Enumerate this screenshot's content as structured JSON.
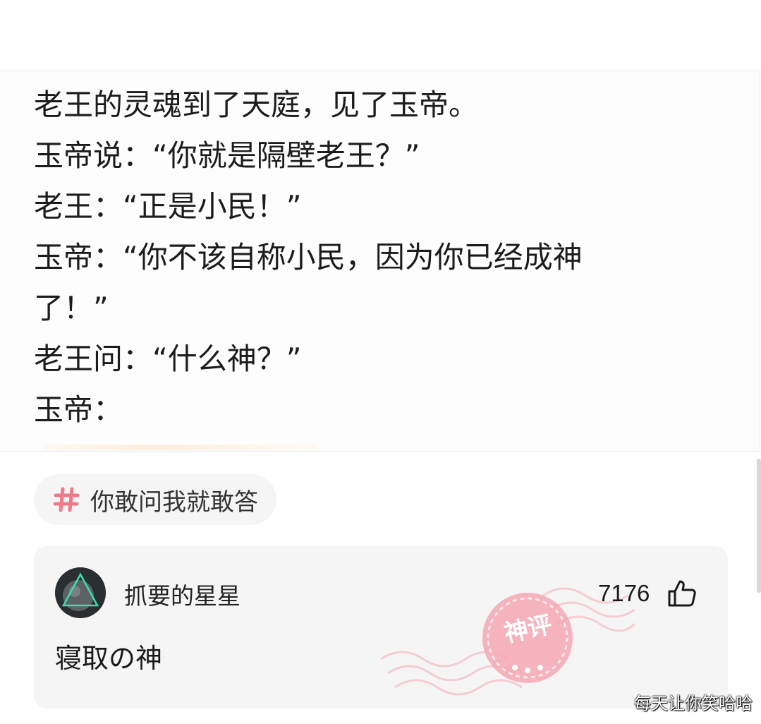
{
  "post": {
    "lines": [
      "老王的灵魂到了天庭，见了玉帝。",
      "玉帝说：“你就是隔壁老王？”",
      "老王：“正是小民！”",
      "玉帝：“你不该自称小民，因为你已经成神",
      "了！”",
      "老王问：“什么神？”",
      "玉帝："
    ]
  },
  "topic": {
    "icon": "hash-icon",
    "label": "你敢问我就敢答"
  },
  "comment": {
    "avatar_icon": "avatar-icon",
    "username": "抓要的星星",
    "likes": "7176",
    "like_icon": "thumbs-up-icon",
    "text": "寝取の神",
    "badge": {
      "icon": "god-comment-stamp",
      "label": "神评"
    }
  },
  "watermark": "每天让你笑哈哈",
  "colors": {
    "accent_pink": "#f07a8a",
    "card_background": "#f5f5f5",
    "stamp_pink": "#f4a7b3"
  }
}
